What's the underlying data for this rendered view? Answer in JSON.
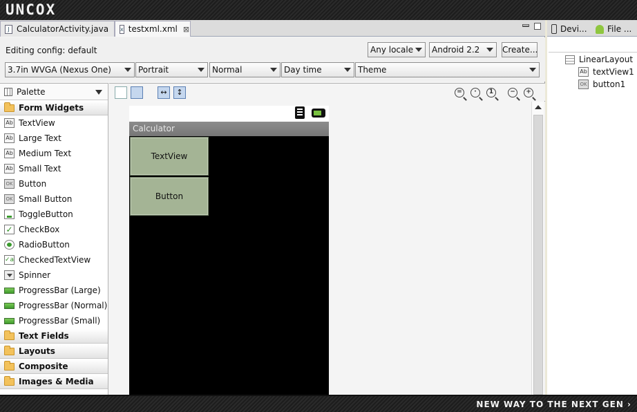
{
  "banner": {
    "brand": "UNCOX",
    "tagline": "NEW WAY TO THE NEXT GEN ›"
  },
  "tabs": [
    {
      "label": "CalculatorActivity.java",
      "icon": "java-file-icon"
    },
    {
      "label": "testxml.xml",
      "icon": "xml-file-icon"
    }
  ],
  "config": {
    "label": "Editing config:  default",
    "locale": "Any locale",
    "api": "Android 2.2",
    "create": "Create...",
    "device": "3.7in WVGA (Nexus One)",
    "orientation": "Portrait",
    "dock": "Normal",
    "time": "Day time",
    "theme": "Theme"
  },
  "palette": {
    "title": "Palette",
    "form_widgets": "Form Widgets",
    "items": [
      {
        "label": "TextView",
        "glyph": "Ab"
      },
      {
        "label": "Large Text",
        "glyph": "Ab"
      },
      {
        "label": "Medium Text",
        "glyph": "Ab"
      },
      {
        "label": "Small Text",
        "glyph": "Ab"
      },
      {
        "label": "Button",
        "glyph": "OK"
      },
      {
        "label": "Small Button",
        "glyph": "OK"
      },
      {
        "label": "ToggleButton",
        "glyph": ""
      },
      {
        "label": "CheckBox",
        "glyph": "✓"
      },
      {
        "label": "RadioButton",
        "glyph": ""
      },
      {
        "label": "CheckedTextView",
        "glyph": "✓a"
      },
      {
        "label": "Spinner",
        "glyph": ""
      },
      {
        "label": "ProgressBar (Large)",
        "glyph": ""
      },
      {
        "label": "ProgressBar (Normal)",
        "glyph": ""
      },
      {
        "label": "ProgressBar (Small)",
        "glyph": ""
      }
    ],
    "categories": [
      "Text Fields",
      "Layouts",
      "Composite",
      "Images & Media"
    ]
  },
  "canvas": {
    "title": "Calculator",
    "textview": "TextView",
    "button": "Button"
  },
  "outline": {
    "tab_devices": "Devi...",
    "tab_file": "File ...",
    "root": "LinearLayout",
    "children": [
      {
        "label": "textView1",
        "glyph": "Ab"
      },
      {
        "label": "button1",
        "glyph": "OK"
      }
    ]
  },
  "colors": {
    "widget": "#a4b495",
    "title_bar": "#808080",
    "screen": "#000000",
    "progress": "#4fa83a"
  }
}
